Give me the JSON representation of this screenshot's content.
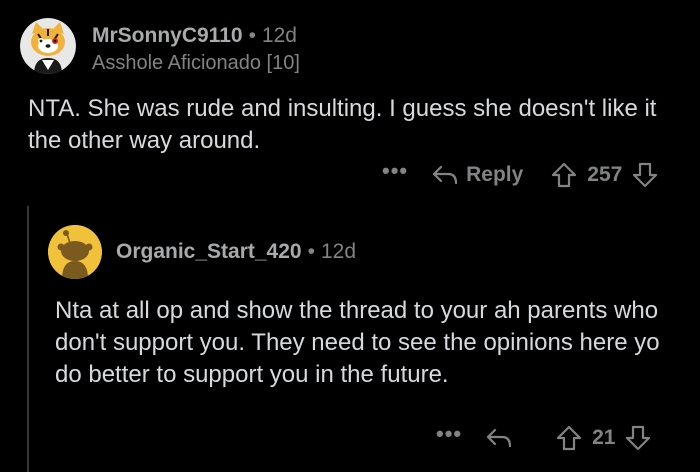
{
  "comment": {
    "author": "MrSonnyC9110",
    "separator": "•",
    "age": "12d",
    "flair": "Asshole Aficionado [10]",
    "body": "NTA.  She was rude and insulting.   I guess she doesn't like it the other way around.",
    "actions": {
      "more": "•••",
      "reply_label": "Reply",
      "score": "257"
    }
  },
  "reply": {
    "author": "Organic_Start_420",
    "separator": "•",
    "age": "12d",
    "body": "Nta at all op and show the thread  to your  ah parents who don't support  you. They need to see the opinions  here yo do better to support  you in the future.",
    "actions": {
      "more": "•••",
      "score": "21"
    }
  },
  "colors": {
    "background": "#000000",
    "text": "#d7dadc",
    "muted": "#818384",
    "thread_line": "#343536",
    "avatar_yellow": "#f0c13a"
  },
  "icons": {
    "reply": "reply-arrow-icon",
    "upvote": "upvote-arrow-icon",
    "downvote": "downvote-arrow-icon",
    "more": "more-options-icon"
  }
}
